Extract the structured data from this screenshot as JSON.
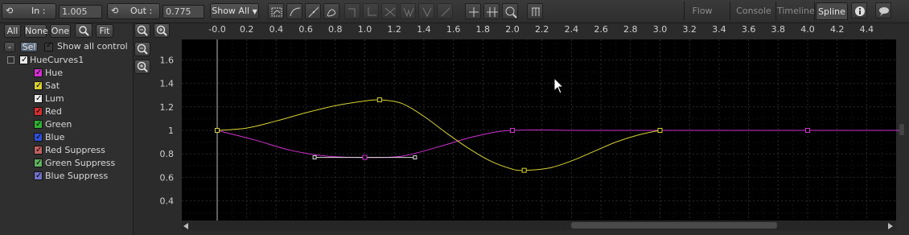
{
  "toolbar": {
    "in_label": "In :",
    "in_value": "1.005",
    "out_label": "Out :",
    "out_value": "0.775",
    "show_all": "Show All",
    "tabs": [
      {
        "label": "Flow",
        "active": false
      },
      {
        "label": "Console",
        "active": false
      },
      {
        "label": "Timeline",
        "active": false
      },
      {
        "label": "Spline",
        "active": true
      }
    ]
  },
  "left": {
    "buttons": {
      "all": "All",
      "none": "None",
      "one": "One",
      "fit": "Fit",
      "minus": "-",
      "sel": "Sel"
    },
    "show_all_control": "Show all control",
    "root": "HueCurves1",
    "items": [
      {
        "label": "Hue",
        "color": "#d030d0"
      },
      {
        "label": "Sat",
        "color": "#d8d030"
      },
      {
        "label": "Lum",
        "color": "#e8e8e8"
      },
      {
        "label": "Red",
        "color": "#d03030"
      },
      {
        "label": "Green",
        "color": "#30b030"
      },
      {
        "label": "Blue",
        "color": "#3050d8"
      },
      {
        "label": "Red Suppress",
        "color": "#c06060"
      },
      {
        "label": "Green Suppress",
        "color": "#60b060"
      },
      {
        "label": "Blue Suppress",
        "color": "#7070c8"
      }
    ]
  },
  "chart_data": {
    "type": "line",
    "xlim": [
      -0.2,
      4.6
    ],
    "ylim": [
      0.15,
      1.75
    ],
    "x_ticks": [
      "-0.0",
      "0.2",
      "0.4",
      "0.6",
      "0.8",
      "1.0",
      "1.2",
      "1.4",
      "1.6",
      "1.8",
      "2.0",
      "2.2",
      "2.4",
      "2.6",
      "2.8",
      "3.0",
      "3.2",
      "3.4",
      "3.6",
      "3.8",
      "4.0",
      "4.2",
      "4.4"
    ],
    "y_ticks": [
      "1.6",
      "1.4",
      "1.2",
      "1",
      "0.8",
      "0.6",
      "0.4"
    ],
    "series": [
      {
        "name": "Hue",
        "color": "#d030d0",
        "keys": [
          [
            0.0,
            1.0
          ],
          [
            1.0,
            0.77
          ],
          [
            2.0,
            1.0
          ],
          [
            3.0,
            1.0
          ],
          [
            4.0,
            1.0
          ]
        ],
        "curve": [
          [
            0.0,
            1.0
          ],
          [
            0.25,
            0.92
          ],
          [
            0.5,
            0.83
          ],
          [
            0.75,
            0.78
          ],
          [
            1.0,
            0.77
          ],
          [
            1.25,
            0.78
          ],
          [
            1.5,
            0.86
          ],
          [
            1.75,
            0.95
          ],
          [
            2.0,
            1.0
          ],
          [
            2.5,
            1.0
          ],
          [
            3.0,
            1.0
          ],
          [
            3.5,
            1.0
          ],
          [
            4.0,
            1.0
          ],
          [
            4.65,
            1.0
          ]
        ],
        "handles": [
          [
            0.66,
            0.77
          ],
          [
            1.0,
            0.77
          ],
          [
            1.34,
            0.77
          ]
        ]
      },
      {
        "name": "Sat",
        "color": "#d8d030",
        "keys": [
          [
            0.0,
            1.0
          ],
          [
            1.1,
            1.26
          ],
          [
            2.08,
            0.66
          ],
          [
            3.0,
            1.0
          ]
        ],
        "curve": [
          [
            0.0,
            1.0
          ],
          [
            0.2,
            1.02
          ],
          [
            0.4,
            1.08
          ],
          [
            0.6,
            1.15
          ],
          [
            0.8,
            1.21
          ],
          [
            1.0,
            1.25
          ],
          [
            1.1,
            1.26
          ],
          [
            1.25,
            1.23
          ],
          [
            1.4,
            1.12
          ],
          [
            1.55,
            0.98
          ],
          [
            1.7,
            0.85
          ],
          [
            1.85,
            0.74
          ],
          [
            2.0,
            0.67
          ],
          [
            2.08,
            0.66
          ],
          [
            2.25,
            0.68
          ],
          [
            2.4,
            0.74
          ],
          [
            2.55,
            0.82
          ],
          [
            2.7,
            0.9
          ],
          [
            2.85,
            0.96
          ],
          [
            3.0,
            1.0
          ]
        ]
      }
    ]
  }
}
